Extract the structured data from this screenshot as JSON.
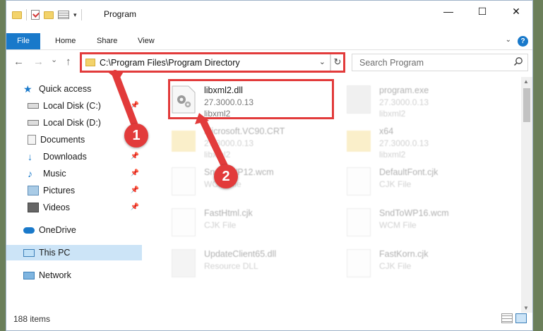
{
  "window": {
    "title": "Program",
    "controls": {
      "minimize": "—",
      "maximize": "☐",
      "close": "✕"
    }
  },
  "ribbon": {
    "tabs": [
      "File",
      "Home",
      "Share",
      "View"
    ],
    "help": "?"
  },
  "nav": {
    "back": "←",
    "forward": "→",
    "recent": "⌄",
    "up": "↑",
    "address": "C:\\Program Files\\Program Directory",
    "refresh": "↻",
    "search_placeholder": "Search Program"
  },
  "sidebar": {
    "items": [
      {
        "label": "Quick access",
        "icon": "star-icon",
        "pinned": false
      },
      {
        "label": "Local Disk (C:)",
        "icon": "drive-icon",
        "pinned": true
      },
      {
        "label": "Local Disk (D:)",
        "icon": "drive-icon",
        "pinned": false
      },
      {
        "label": "Documents",
        "icon": "documents-icon",
        "pinned": true
      },
      {
        "label": "Downloads",
        "icon": "download-icon",
        "pinned": true
      },
      {
        "label": "Music",
        "icon": "music-icon",
        "pinned": true
      },
      {
        "label": "Pictures",
        "icon": "pictures-icon",
        "pinned": true
      },
      {
        "label": "Videos",
        "icon": "videos-icon",
        "pinned": true
      },
      {
        "label": "OneDrive",
        "icon": "cloud-icon",
        "pinned": false
      },
      {
        "label": "This PC",
        "icon": "pc-icon",
        "pinned": false,
        "selected": true
      },
      {
        "label": "Network",
        "icon": "network-icon",
        "pinned": false
      }
    ]
  },
  "files": [
    {
      "name": "libxml2.dll",
      "line1": "27.3000.0.13",
      "line2": "libxml2",
      "icon": "dll-gear-icon",
      "highlighted": true
    },
    {
      "name": "program.exe",
      "line1": "27.3000.0.13",
      "line2": "libxml2",
      "icon": "exe-icon",
      "dim": true
    },
    {
      "name": "Microsoft.VC90.CRT",
      "line1": "27.3000.0.13",
      "line2": "libxml2",
      "icon": "folder-icon",
      "dim": true
    },
    {
      "name": "x64",
      "line1": "27.3000.0.13",
      "line2": "libxml2",
      "icon": "folder-icon",
      "dim": true
    },
    {
      "name": "SndToWP12.wcm",
      "line1": "WCM File",
      "line2": "",
      "icon": "file-icon",
      "dim": true
    },
    {
      "name": "DefaultFont.cjk",
      "line1": "CJK File",
      "line2": "",
      "icon": "file-icon",
      "dim": true
    },
    {
      "name": "FastHtml.cjk",
      "line1": "CJK File",
      "line2": "",
      "icon": "file-icon",
      "dim": true
    },
    {
      "name": "SndToWP16.wcm",
      "line1": "WCM File",
      "line2": "",
      "icon": "file-icon",
      "dim": true
    },
    {
      "name": "UpdateClient65.dll",
      "line1": "Resource DLL",
      "line2": "",
      "icon": "dll-gear-icon",
      "dim": true
    },
    {
      "name": "FastKorn.cjk",
      "line1": "CJK File",
      "line2": "",
      "icon": "file-icon",
      "dim": true
    }
  ],
  "status": {
    "count": "188 items"
  },
  "annotations": [
    "1",
    "2"
  ],
  "colors": {
    "accent": "#1979ca",
    "annotation": "#e23b3b",
    "selection": "#cce4f7"
  }
}
